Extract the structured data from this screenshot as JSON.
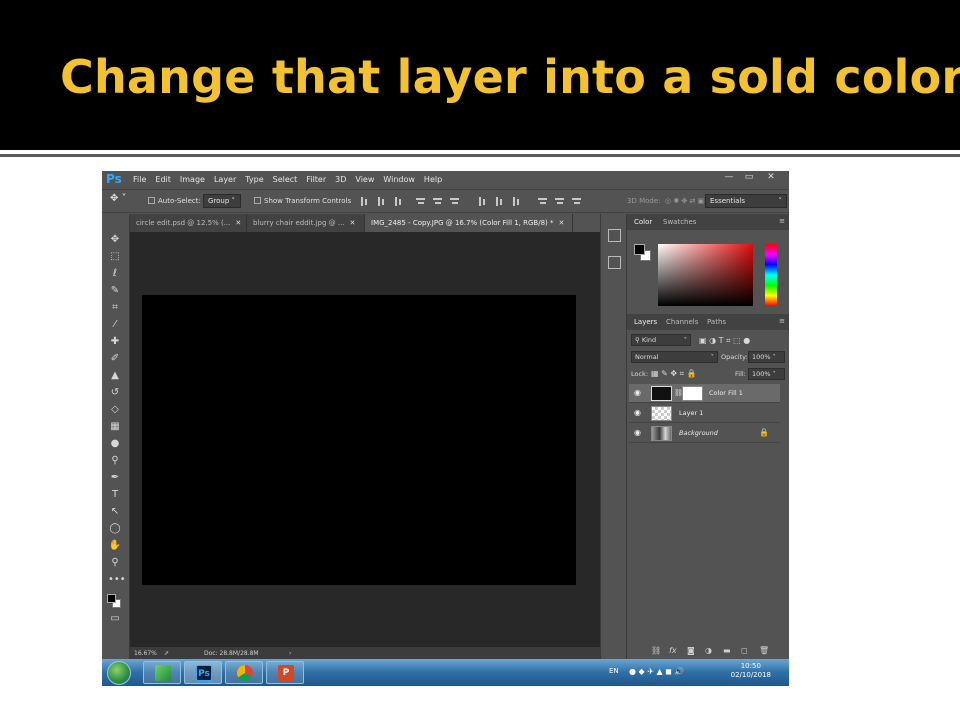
{
  "slide": {
    "title": "Change that layer into a sold color"
  },
  "app": {
    "logo": "Ps",
    "menu": [
      "File",
      "Edit",
      "Image",
      "Layer",
      "Type",
      "Select",
      "Filter",
      "3D",
      "View",
      "Window",
      "Help"
    ],
    "window_controls": [
      "—",
      "▭",
      "✕"
    ]
  },
  "options": {
    "auto_select_label": "Auto-Select:",
    "auto_select_value": "Group",
    "show_transform_label": "Show Transform Controls",
    "mode_3d_label": "3D Mode:",
    "workspace": "Essentials"
  },
  "tabs": [
    {
      "label": "circle edit.psd @ 12.5% (...",
      "close": "✕"
    },
    {
      "label": "blurry chair eddit.jpg @ ...",
      "close": "✕"
    },
    {
      "label": "IMG_2485 - Copy.JPG @ 16.7% (Color Fill 1, RGB/8) *",
      "close": "✕"
    }
  ],
  "status": {
    "zoom": "16.67%",
    "doc": "Doc: 28.8M/28.8M",
    "arrow": "›"
  },
  "color_panel": {
    "tabs": [
      "Color",
      "Swatches"
    ],
    "menu": "≡"
  },
  "layers_panel": {
    "tabs": [
      "Layers",
      "Channels",
      "Paths"
    ],
    "menu": "≡",
    "filter_kind": "Kind",
    "blend_mode": "Normal",
    "opacity_label": "Opacity:",
    "opacity_value": "100%",
    "lock_label": "Lock:",
    "fill_label": "Fill:",
    "fill_value": "100%",
    "layers": [
      {
        "name": "Color Fill 1",
        "selected": true
      },
      {
        "name": "Layer 1",
        "selected": false
      },
      {
        "name": "Background",
        "selected": false,
        "locked": true
      }
    ],
    "footer_icons": [
      "link-icon",
      "fx-icon",
      "mask-icon",
      "adjustment-icon",
      "folder-icon",
      "new-layer-icon",
      "trash-icon"
    ],
    "footer_fx": "fx"
  },
  "taskbar": {
    "apps": [
      "Ps",
      "P"
    ],
    "language": "EN",
    "time": "10:50",
    "date": "02/10/2018"
  },
  "colors": {
    "title": "#f2c232",
    "ps_blue": "#31a8ff",
    "ui_gray": "#535353",
    "canvas_bg": "#282828"
  }
}
